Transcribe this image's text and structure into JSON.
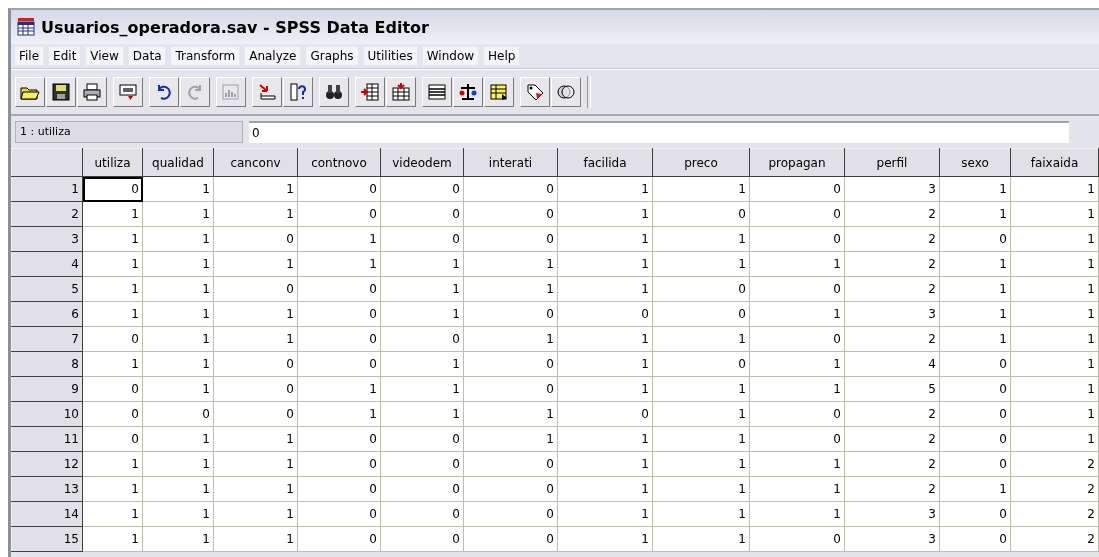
{
  "window": {
    "title": "Usuarios_operadora.sav - SPSS Data Editor"
  },
  "menu": [
    "File",
    "Edit",
    "View",
    "Data",
    "Transform",
    "Analyze",
    "Graphs",
    "Utilities",
    "Window",
    "Help"
  ],
  "toolbar": [
    [
      {
        "kind": "open",
        "disabled": false
      },
      {
        "kind": "save",
        "disabled": false
      },
      {
        "kind": "print",
        "disabled": false
      }
    ],
    [
      {
        "kind": "recall",
        "disabled": false
      }
    ],
    [
      {
        "kind": "undo",
        "disabled": false
      },
      {
        "kind": "redo",
        "disabled": true
      }
    ],
    [
      {
        "kind": "chart",
        "disabled": true
      }
    ],
    [
      {
        "kind": "goto",
        "disabled": false
      },
      {
        "kind": "variables",
        "disabled": false
      }
    ],
    [
      {
        "kind": "find",
        "disabled": false
      }
    ],
    [
      {
        "kind": "insert-case",
        "disabled": false
      },
      {
        "kind": "insert-variable",
        "disabled": false
      }
    ],
    [
      {
        "kind": "split",
        "disabled": false
      },
      {
        "kind": "weight",
        "disabled": false
      },
      {
        "kind": "select",
        "disabled": false
      }
    ],
    [
      {
        "kind": "labels",
        "disabled": false
      },
      {
        "kind": "sets",
        "disabled": false
      }
    ]
  ],
  "cell_editor": {
    "cell": "1 : utiliza",
    "value": "0"
  },
  "table": {
    "columns": [
      "utiliza",
      "qualidad",
      "canconv",
      "contnovo",
      "videodem",
      "interati",
      "facilida",
      "preco",
      "propagan",
      "perfil",
      "sexo",
      "faixaida"
    ],
    "rows": [
      {
        "label": "1",
        "cells": [
          "0",
          "1",
          "1",
          "0",
          "0",
          "0",
          "1",
          "1",
          "0",
          "3",
          "1",
          "1"
        ],
        "selected": true
      },
      {
        "label": "2",
        "cells": [
          "1",
          "1",
          "1",
          "0",
          "0",
          "0",
          "1",
          "0",
          "0",
          "2",
          "1",
          "1"
        ]
      },
      {
        "label": "3",
        "cells": [
          "1",
          "1",
          "0",
          "1",
          "0",
          "0",
          "1",
          "1",
          "0",
          "2",
          "0",
          "1"
        ]
      },
      {
        "label": "4",
        "cells": [
          "1",
          "1",
          "1",
          "1",
          "1",
          "1",
          "1",
          "1",
          "1",
          "2",
          "1",
          "1"
        ]
      },
      {
        "label": "5",
        "cells": [
          "1",
          "1",
          "0",
          "0",
          "1",
          "1",
          "1",
          "0",
          "0",
          "2",
          "1",
          "1"
        ]
      },
      {
        "label": "6",
        "cells": [
          "1",
          "1",
          "1",
          "0",
          "1",
          "0",
          "0",
          "0",
          "1",
          "3",
          "1",
          "1"
        ]
      },
      {
        "label": "7",
        "cells": [
          "0",
          "1",
          "1",
          "0",
          "0",
          "1",
          "1",
          "1",
          "0",
          "2",
          "1",
          "1"
        ]
      },
      {
        "label": "8",
        "cells": [
          "1",
          "1",
          "0",
          "0",
          "1",
          "0",
          "1",
          "0",
          "1",
          "4",
          "0",
          "1"
        ]
      },
      {
        "label": "9",
        "cells": [
          "0",
          "1",
          "0",
          "1",
          "1",
          "0",
          "1",
          "1",
          "1",
          "5",
          "0",
          "1"
        ]
      },
      {
        "label": "10",
        "cells": [
          "0",
          "0",
          "0",
          "1",
          "1",
          "1",
          "0",
          "1",
          "0",
          "2",
          "0",
          "1"
        ]
      },
      {
        "label": "11",
        "cells": [
          "0",
          "1",
          "1",
          "0",
          "0",
          "1",
          "1",
          "1",
          "0",
          "2",
          "0",
          "1"
        ]
      },
      {
        "label": "12",
        "cells": [
          "1",
          "1",
          "1",
          "0",
          "0",
          "0",
          "1",
          "1",
          "1",
          "2",
          "0",
          "2"
        ]
      },
      {
        "label": "13",
        "cells": [
          "1",
          "1",
          "1",
          "0",
          "0",
          "0",
          "1",
          "1",
          "1",
          "2",
          "1",
          "2"
        ]
      },
      {
        "label": "14",
        "cells": [
          "1",
          "1",
          "1",
          "0",
          "0",
          "0",
          "1",
          "1",
          "1",
          "3",
          "0",
          "2"
        ]
      },
      {
        "label": "15",
        "cells": [
          "1",
          "1",
          "1",
          "0",
          "0",
          "0",
          "1",
          "1",
          "0",
          "3",
          "0",
          "2"
        ]
      }
    ]
  }
}
